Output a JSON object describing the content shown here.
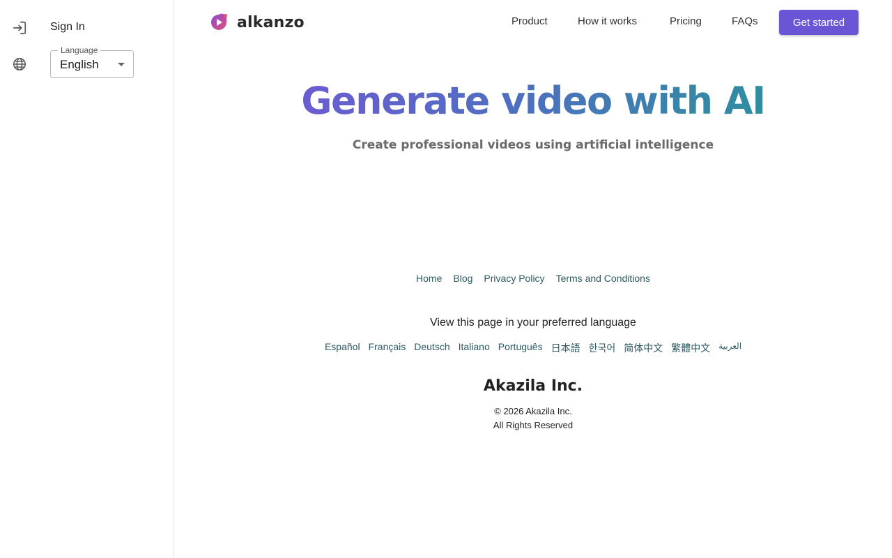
{
  "sidebar": {
    "sign_in_label": "Sign In",
    "sign_in_icon": "login-icon",
    "language_icon": "globe-icon",
    "language": {
      "legend": "Language",
      "selected": "English"
    }
  },
  "header": {
    "logo_text": "alkanzo",
    "logo_icon": "play-logo-icon",
    "nav": [
      {
        "label": "Product"
      },
      {
        "label": "How it works"
      },
      {
        "label": "Pricing"
      },
      {
        "label": "FAQs"
      }
    ],
    "cta_label": "Get started"
  },
  "hero": {
    "title": "Generate video with AI",
    "subtitle": "Create professional videos using artificial intelligence"
  },
  "footer": {
    "links": [
      {
        "label": "Home"
      },
      {
        "label": "Blog"
      },
      {
        "label": "Privacy Policy"
      },
      {
        "label": "Terms and Conditions"
      }
    ],
    "language_prompt": "View this page in your preferred language",
    "languages": [
      {
        "label": "Español"
      },
      {
        "label": "Français"
      },
      {
        "label": "Deutsch"
      },
      {
        "label": "Italiano"
      },
      {
        "label": "Português"
      },
      {
        "label": "日本語"
      },
      {
        "label": "한국어"
      },
      {
        "label": "简体中文"
      },
      {
        "label": "繁體中文"
      },
      {
        "label": "العربية"
      }
    ],
    "company": "Akazila Inc.",
    "copyright": "© 2026 Akazila Inc.",
    "rights": "All Rights Reserved"
  },
  "colors": {
    "brand": "#6a55d6",
    "link": "#2c5a62",
    "gradient_start": "#6b5cd1",
    "gradient_end": "#2f8e9f"
  }
}
